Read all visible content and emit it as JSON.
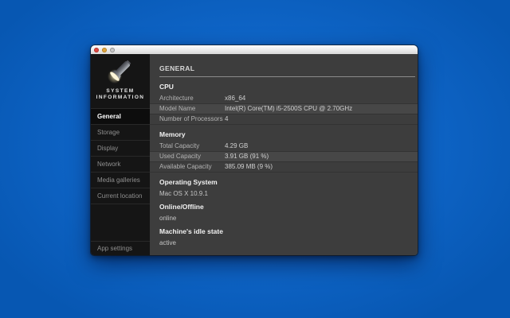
{
  "window": {
    "titlebar": {
      "buttons": [
        "close",
        "minimize",
        "zoom"
      ]
    },
    "sidebar": {
      "title_line1": "SYSTEM",
      "title_line2": "INFORMATION",
      "items": [
        {
          "label": "General",
          "selected": true
        },
        {
          "label": "Storage",
          "selected": false
        },
        {
          "label": "Display",
          "selected": false
        },
        {
          "label": "Network",
          "selected": false
        },
        {
          "label": "Media galleries",
          "selected": false
        },
        {
          "label": "Current location",
          "selected": false
        }
      ],
      "bottom_item": "App settings"
    },
    "main": {
      "page_title": "GENERAL",
      "sections": [
        {
          "title": "CPU",
          "rows": [
            {
              "label": "Architecture",
              "value": "x86_64"
            },
            {
              "label": "Model Name",
              "value": "Intel(R) Core(TM) i5-2500S CPU @ 2.70GHz"
            },
            {
              "label": "Number of Processors",
              "value": "4"
            }
          ]
        },
        {
          "title": "Memory",
          "rows": [
            {
              "label": "Total Capacity",
              "value": "4.29 GB"
            },
            {
              "label": "Used Capacity",
              "value": "3.91 GB (91 %)"
            },
            {
              "label": "Available Capacity",
              "value": "385.09 MB (9 %)"
            }
          ]
        },
        {
          "title": "Operating System",
          "value": "Mac OS X 10.9.1"
        },
        {
          "title": "Online/Offline",
          "value": "online"
        },
        {
          "title": "Machine's idle state",
          "value": "active"
        }
      ]
    }
  },
  "icons": {
    "flashlight": "flashlight-icon"
  },
  "colors": {
    "desktop_blue_center": "#1777e6",
    "desktop_blue_edge": "#0757b2",
    "sidebar_bg": "#151515",
    "sidebar_selected_bg": "#0d0d0d",
    "panel_bg": "#3d3d3d",
    "row_stripe": "#474747",
    "close_red": "#df4944",
    "minimize_yellow": "#dfa63f"
  }
}
